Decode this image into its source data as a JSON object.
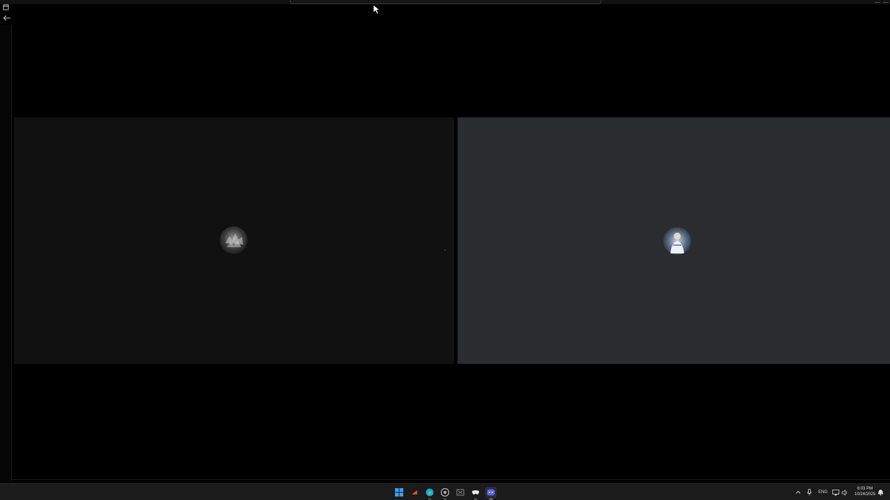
{
  "taskbar": {
    "language": "ENG",
    "time": "6:03 PM",
    "date": "10/24/2025",
    "apps": [
      {
        "name": "start",
        "icon": "windows-start-icon"
      },
      {
        "name": "app-red",
        "icon": "red-app-icon"
      },
      {
        "name": "edge",
        "icon": "edge-browser-icon"
      },
      {
        "name": "chrome",
        "icon": "chrome-icon"
      },
      {
        "name": "app-outline",
        "icon": "outline-app-icon"
      },
      {
        "name": "app-mask",
        "icon": "mask-app-icon"
      },
      {
        "name": "discord",
        "icon": "discord-icon"
      }
    ]
  },
  "call": {
    "tiles": [
      {
        "avatar_icon": "participant-avatar",
        "background": "#111111"
      },
      {
        "avatar_icon": "participant-avatar",
        "background": "#2b2c2f"
      }
    ]
  },
  "colors": {
    "taskbar_bg": "#1b1b1b",
    "discord_accent": "#5865f2",
    "windows_blue": "#3aa0f0"
  }
}
